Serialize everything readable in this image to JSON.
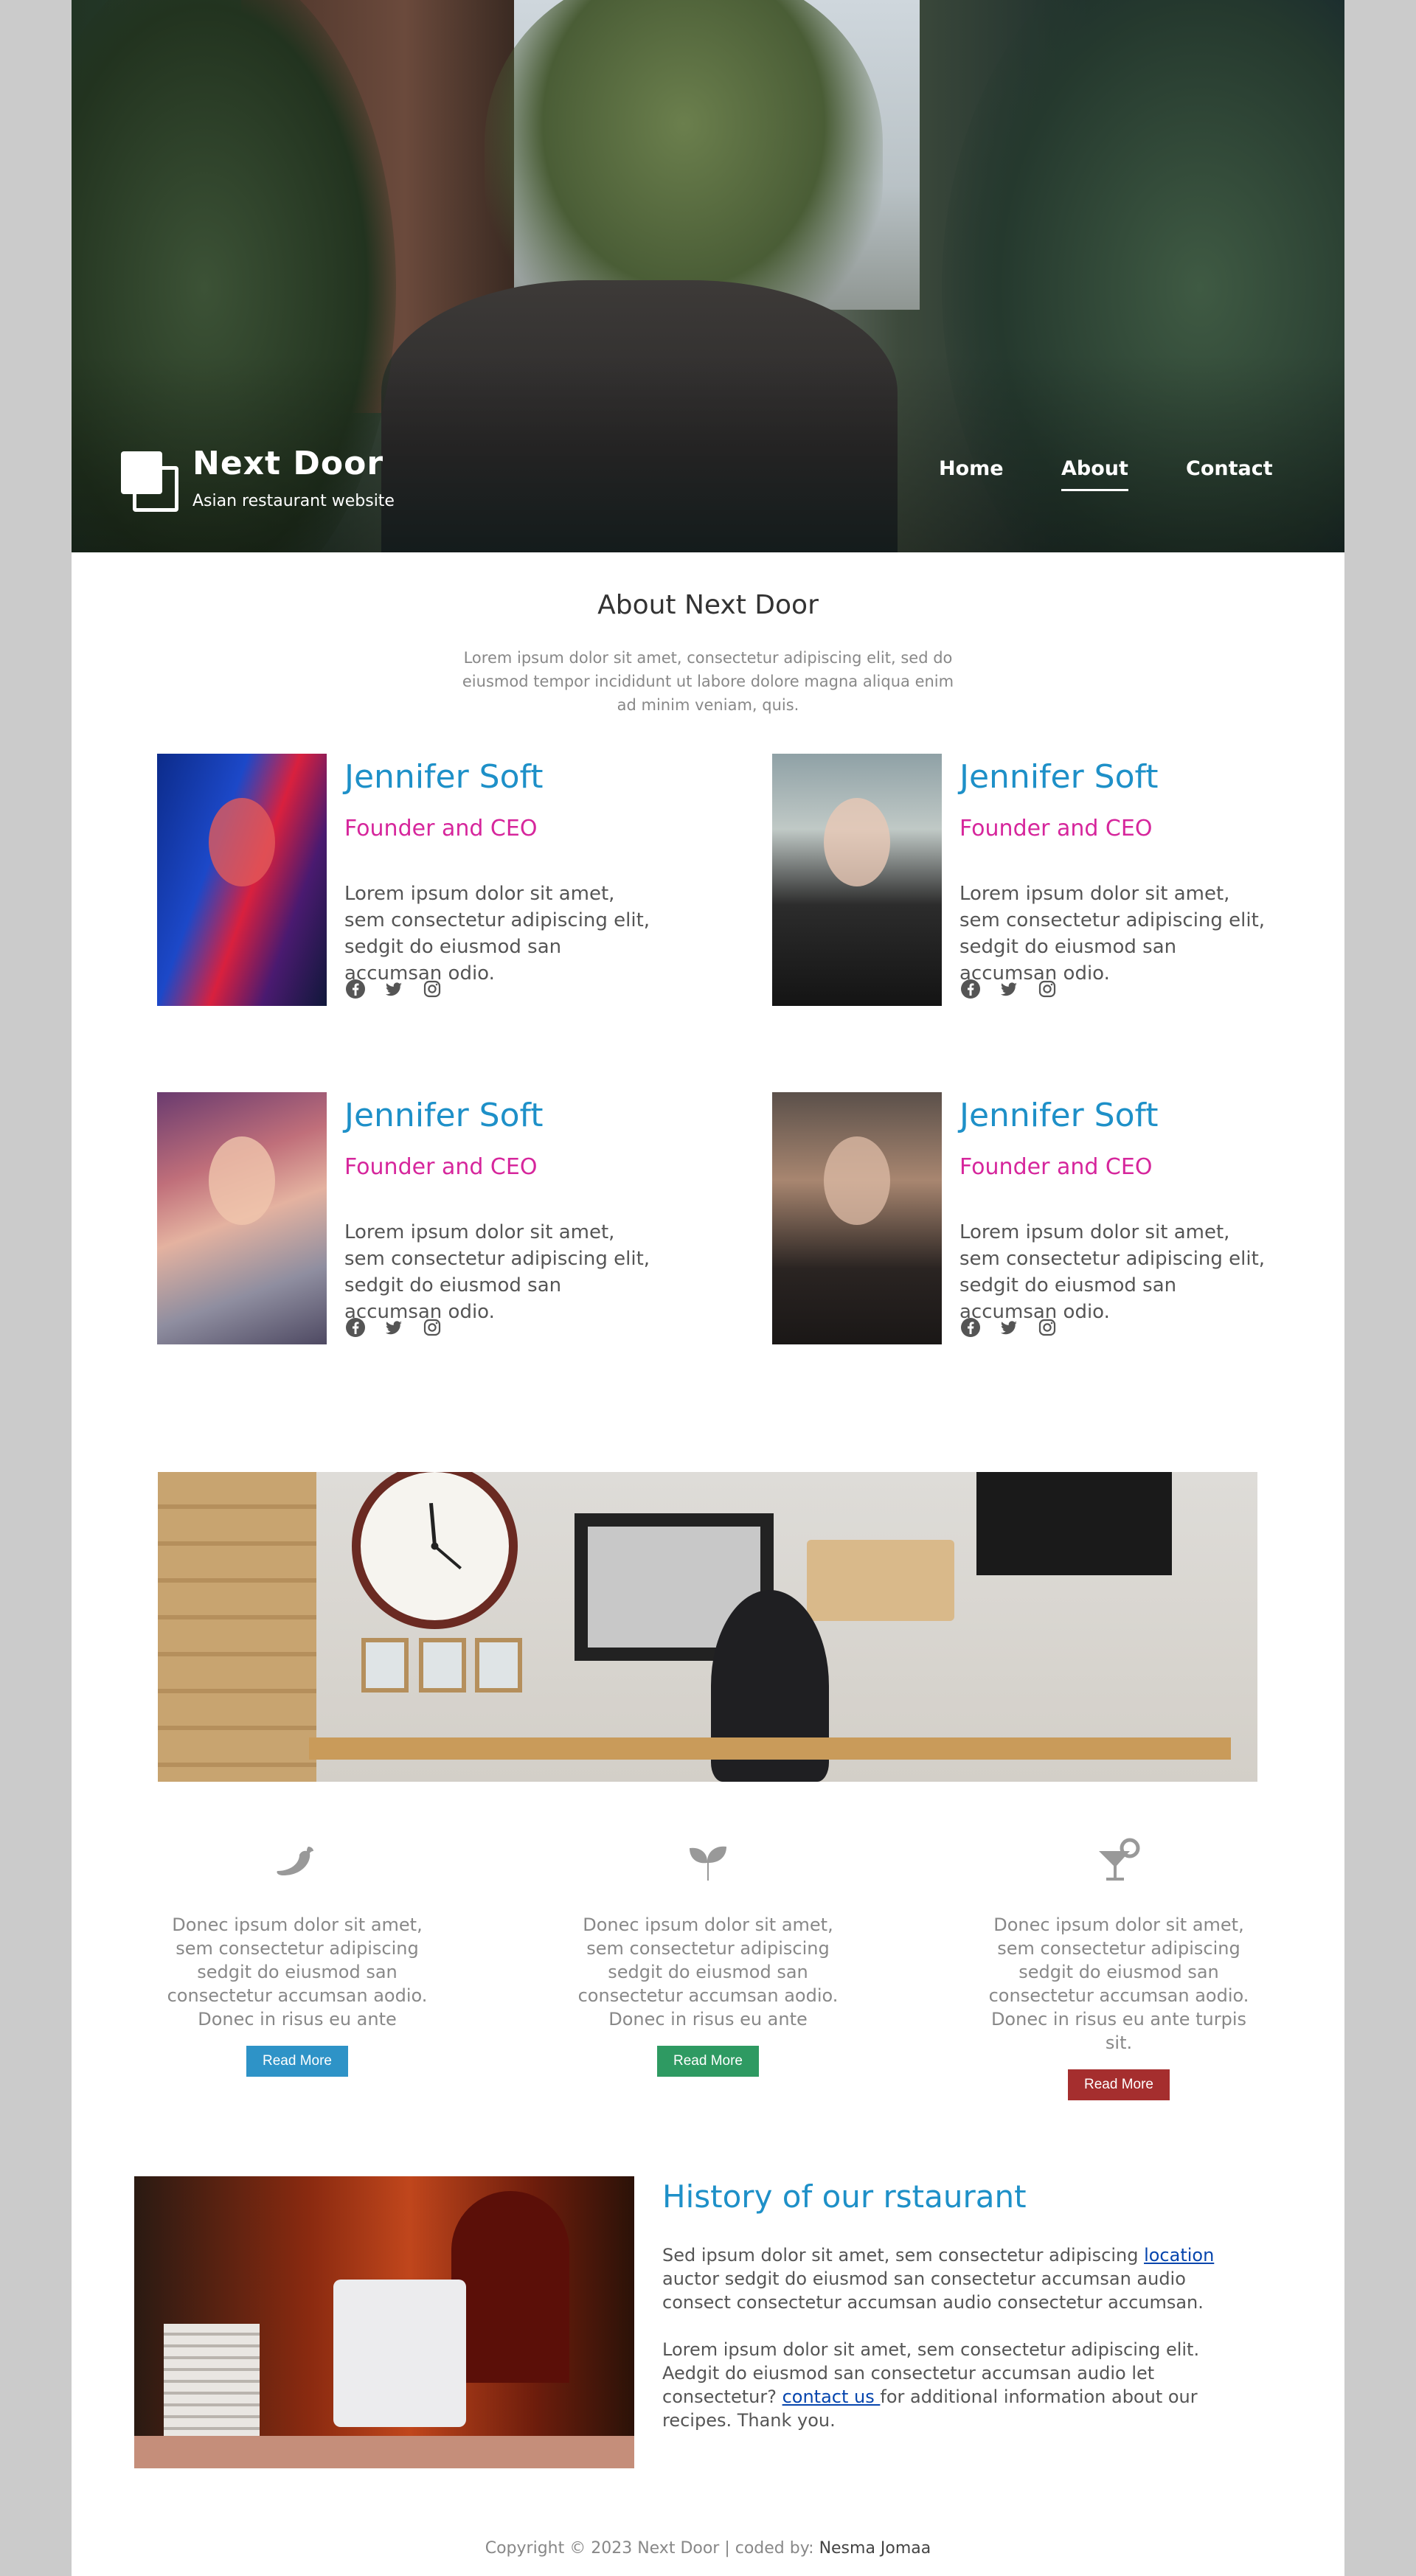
{
  "header": {
    "brand": "Next Door",
    "tagline": "Asian restaurant website",
    "nav": [
      "Home",
      "About",
      "Contact"
    ],
    "active_nav": "About"
  },
  "about": {
    "title": "About Next Door",
    "intro": "Lorem ipsum dolor sit amet, consectetur adipiscing elit, sed do eiusmod tempor incididunt ut labore dolore magna aliqua enim ad minim veniam, quis."
  },
  "team": [
    {
      "name": "Jennifer Soft",
      "role": "Founder and CEO",
      "bio": "Lorem ipsum dolor sit amet, sem consectetur adipiscing elit, sedgit do eiusmod san accumsan odio.",
      "social": [
        "facebook-icon",
        "twitter-icon",
        "instagram-icon"
      ]
    },
    {
      "name": "Jennifer Soft",
      "role": "Founder and CEO",
      "bio": "Lorem ipsum dolor sit amet, sem consectetur adipiscing elit, sedgit do eiusmod san accumsan odio.",
      "social": [
        "facebook-icon",
        "twitter-icon",
        "instagram-icon"
      ]
    },
    {
      "name": "Jennifer Soft",
      "role": "Founder and CEO",
      "bio": "Lorem ipsum dolor sit amet, sem consectetur adipiscing elit, sedgit do eiusmod san accumsan odio.",
      "social": [
        "facebook-icon",
        "twitter-icon",
        "instagram-icon"
      ]
    },
    {
      "name": "Jennifer Soft",
      "role": "Founder and CEO",
      "bio": "Lorem ipsum dolor sit amet, sem consectetur adipiscing elit, sedgit do eiusmod san accumsan odio.",
      "social": [
        "facebook-icon",
        "twitter-icon",
        "instagram-icon"
      ]
    }
  ],
  "features": [
    {
      "icon": "chili-pepper-icon",
      "text": "Donec ipsum dolor sit amet, sem consectetur adipiscing sedgit do eiusmod san consectetur accumsan aodio. Donec in risus eu ante",
      "button": "Read More",
      "color": "#2e93c7"
    },
    {
      "icon": "leaf-sprout-icon",
      "text": "Donec ipsum dolor sit amet, sem consectetur adipiscing sedgit do eiusmod san consectetur accumsan aodio. Donec in risus eu ante",
      "button": "Read More",
      "color": "#2e9a62"
    },
    {
      "icon": "cocktail-icon",
      "text": "Donec ipsum dolor sit amet, sem consectetur adipiscing sedgit do eiusmod san consectetur accumsan aodio. Donec in risus eu ante turpis sit.",
      "button": "Read More",
      "color": "#a52e2e"
    }
  ],
  "history": {
    "title": "History of our rstaurant",
    "p1_before": "Sed ipsum dolor sit amet, sem consectetur adipiscing ",
    "p1_link": "location",
    "p1_after": " auctor sedgit do eiusmod san consectetur accumsan audio consect consectetur accumsan audio consectetur accumsan.",
    "p2_before": "Lorem ipsum dolor sit amet, sem consectetur adipiscing elit. Aedgit do eiusmod san consectetur accumsan audio let consectetur? ",
    "p2_link": "contact us ",
    "p2_after": "for additional information about our recipes. Thank you."
  },
  "footer": {
    "copyright": "Copyright © 2023 Next Door | coded by: ",
    "author": "Nesma Jomaa"
  },
  "colors": {
    "accent_blue": "#1e90c8",
    "accent_magenta": "#d6269c"
  }
}
